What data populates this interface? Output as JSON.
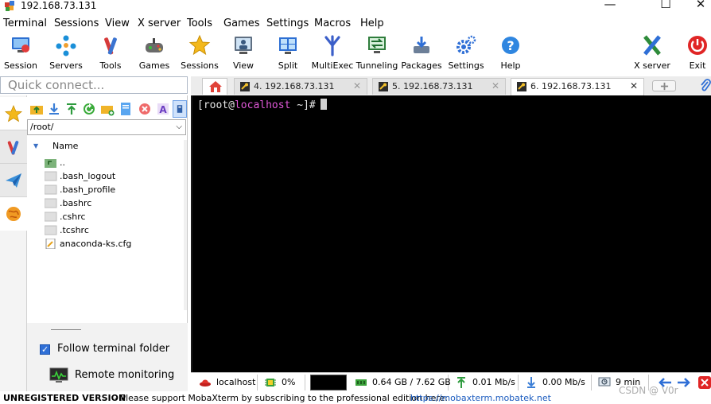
{
  "window": {
    "title": "192.168.73.131",
    "minimize": "—",
    "maximize": "☐",
    "close": "✕"
  },
  "menu": [
    "Terminal",
    "Sessions",
    "View",
    "X server",
    "Tools",
    "Games",
    "Settings",
    "Macros",
    "Help"
  ],
  "toolbar": {
    "session": "Session",
    "servers": "Servers",
    "tools": "Tools",
    "games": "Games",
    "sessions": "Sessions",
    "view": "View",
    "split": "Split",
    "multiexec": "MultiExec",
    "tunneling": "Tunneling",
    "packages": "Packages",
    "settings": "Settings",
    "help": "Help",
    "xserver": "X server",
    "exit": "Exit"
  },
  "quick_connect": {
    "placeholder": "Quick connect..."
  },
  "tabs": [
    {
      "label": "4. 192.168.73.131",
      "close": "✕"
    },
    {
      "label": "5. 192.168.73.131",
      "close": "✕"
    },
    {
      "label": "6. 192.168.73.131",
      "close": "✕"
    }
  ],
  "file_browser": {
    "path": "/root/",
    "column_name": "Name",
    "files": [
      "..",
      ".bash_logout",
      ".bash_profile",
      ".bashrc",
      ".cshrc",
      ".tcshrc",
      "anaconda-ks.cfg"
    ],
    "follow_folder": "Follow terminal folder",
    "remote_monitoring": "Remote monitoring"
  },
  "terminal": {
    "prompt_open": "[root@",
    "prompt_host": "localhost",
    "prompt_close": " ~]#"
  },
  "status": {
    "host": "localhost",
    "cpu": "0%",
    "memory": "0.64 GB / 7.62 GB",
    "upload": "0.01 Mb/s",
    "download": "0.00 Mb/s",
    "time": "9 min"
  },
  "footer": {
    "unregistered": "UNREGISTERED VERSION",
    "message": "-  Please support MobaXterm by subscribing to the professional edition here:",
    "link": "https://mobaxterm.mobatek.net"
  },
  "watermark": "CSDN @ V0r",
  "colors": {
    "accent": "#2f6fd6",
    "terminal_bg": "#000000",
    "host": "#e058d8",
    "link": "#1a5bbf"
  }
}
